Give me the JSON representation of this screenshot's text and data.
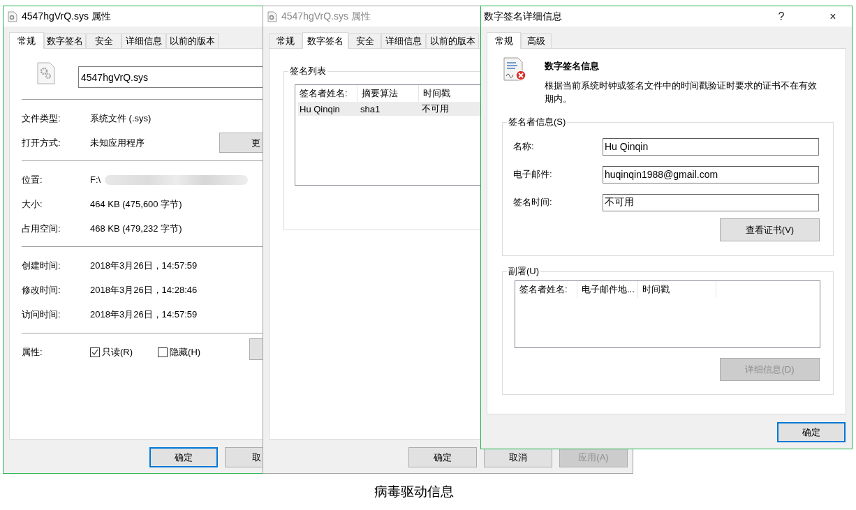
{
  "general_window": {
    "title": "4547hgVrQ.sys 属性",
    "tabs": [
      {
        "label": "常规",
        "selected": true
      },
      {
        "label": "数字签名",
        "selected": false
      },
      {
        "label": "安全",
        "selected": false
      },
      {
        "label": "详细信息",
        "selected": false
      },
      {
        "label": "以前的版本",
        "selected": false
      }
    ],
    "file_name": "4547hgVrQ.sys",
    "groups": [
      [
        {
          "label": "文件类型:",
          "value": "系统文件 (.sys)"
        },
        {
          "label": "打开方式:",
          "value": "未知应用程序",
          "button": "更"
        }
      ],
      [
        {
          "label": "位置:",
          "value": "F:\\"
        },
        {
          "label": "大小:",
          "value": "464 KB (475,600 字节)"
        },
        {
          "label": "占用空间:",
          "value": "468 KB (479,232 字节)"
        }
      ],
      [
        {
          "label": "创建时间:",
          "value": "2018年3月26日，14:57:59"
        },
        {
          "label": "修改时间:",
          "value": "2018年3月26日，14:28:46"
        },
        {
          "label": "访问时间:",
          "value": "2018年3月26日，14:57:59"
        }
      ]
    ],
    "attributes": {
      "label": "属性:",
      "options": [
        {
          "label": "只读(R)",
          "checked": true
        },
        {
          "label": "隐藏(H)",
          "checked": false
        }
      ]
    },
    "buttons": [
      {
        "label": "确定",
        "default": true,
        "disabled": false
      },
      {
        "label": "取",
        "default": false,
        "disabled": false
      }
    ]
  },
  "signature_window": {
    "title": "4547hgVrQ.sys 属性",
    "tabs": [
      {
        "label": "常规",
        "selected": false
      },
      {
        "label": "数字签名",
        "selected": true
      },
      {
        "label": "安全",
        "selected": false
      },
      {
        "label": "详细信息",
        "selected": false
      },
      {
        "label": "以前的版本",
        "selected": false
      }
    ],
    "group_title": "签名列表",
    "columns": [
      "签名者姓名:",
      "摘要算法",
      "时间戳"
    ],
    "rows": [
      {
        "cells": [
          "Hu Qinqin",
          "sha1",
          "不可用"
        ],
        "selected": true
      }
    ],
    "buttons": [
      {
        "label": "确定",
        "default": false,
        "disabled": false
      },
      {
        "label": "取消",
        "default": false,
        "disabled": false
      },
      {
        "label": "应用(A)",
        "default": false,
        "disabled": true
      }
    ]
  },
  "details_dialog": {
    "title": "数字签名详细信息",
    "help": "?",
    "close": "×",
    "tabs": [
      {
        "label": "常规",
        "selected": true
      },
      {
        "label": "高级",
        "selected": false
      }
    ],
    "heading": "数字签名信息",
    "message": "根据当前系统时钟或签名文件中的时间戳验证时要求的证书不在有效期内。",
    "signer_group": {
      "title": "签名者信息(S)",
      "fields": [
        {
          "label": "名称:",
          "value": "Hu Qinqin"
        },
        {
          "label": "电子邮件:",
          "value": "huqinqin1988@gmail.com"
        },
        {
          "label": "签名时间:",
          "value": "不可用"
        }
      ],
      "button": {
        "label": "查看证书(V)",
        "default": false,
        "disabled": false
      }
    },
    "countersign_group": {
      "title": "副署(U)",
      "columns": [
        "签名者姓名:",
        "电子邮件地...",
        "时间戳"
      ],
      "button": {
        "label": "详细信息(D)",
        "default": false,
        "disabled": true
      }
    },
    "buttons": [
      {
        "label": "确定",
        "default": true,
        "disabled": false
      }
    ]
  },
  "caption": "病毒驱动信息"
}
